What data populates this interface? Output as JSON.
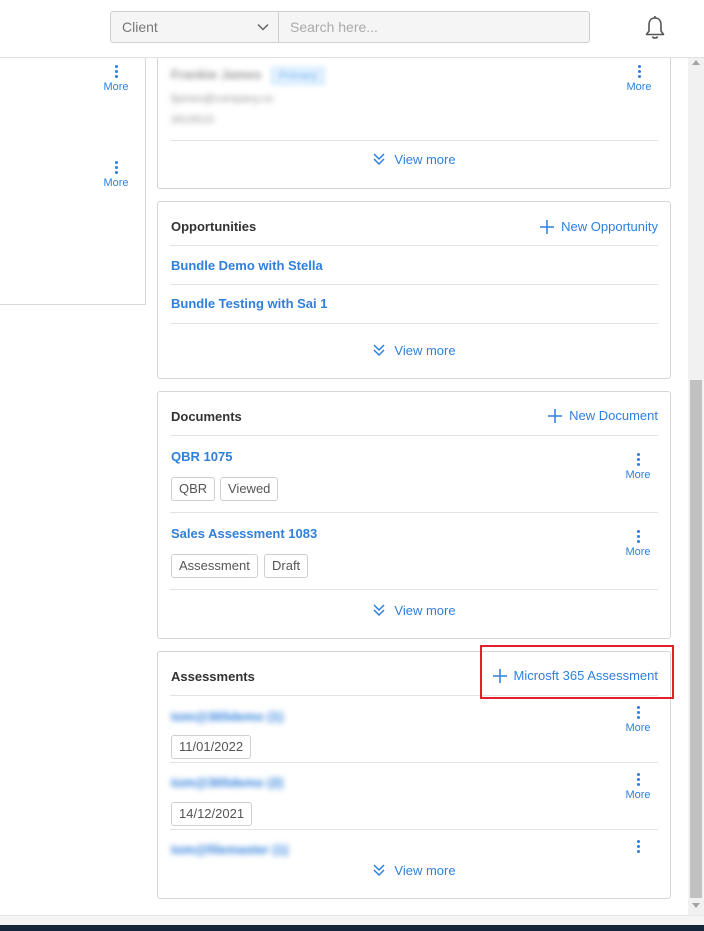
{
  "header": {
    "client_select": "Client",
    "search_placeholder": "Search here..."
  },
  "left_panel": {
    "more_labels": [
      "More",
      "More"
    ]
  },
  "contact_card": {
    "name": "Frankie James",
    "badge": "Primary",
    "email": "fjames@company.co",
    "phone": "0819515",
    "more_label": "More",
    "view_more": "View more"
  },
  "opportunities": {
    "title": "Opportunities",
    "action": "New Opportunity",
    "items": [
      "Bundle Demo with Stella",
      "Bundle Testing with Sai 1"
    ],
    "view_more": "View more"
  },
  "documents": {
    "title": "Documents",
    "action": "New Document",
    "items": [
      {
        "name": "QBR 1075",
        "tags": [
          "QBR",
          "Viewed"
        ],
        "more": "More"
      },
      {
        "name": "Sales Assessment 1083",
        "tags": [
          "Assessment",
          "Draft"
        ],
        "more": "More"
      }
    ],
    "view_more": "View more"
  },
  "assessments": {
    "title": "Assessments",
    "action": "Microsft 365 Assessment",
    "items": [
      {
        "name": "tom@365demo (1)",
        "date": "11/01/2022",
        "more": "More"
      },
      {
        "name": "tom@365demo (2)",
        "date": "14/12/2021",
        "more": "More"
      },
      {
        "name": "tom@filemaster (1)"
      }
    ],
    "view_more": "View more"
  },
  "colors": {
    "accent": "#2f7fdc",
    "highlight": "#e0202a",
    "border": "#d6d6d6",
    "footer": "#14263a"
  }
}
